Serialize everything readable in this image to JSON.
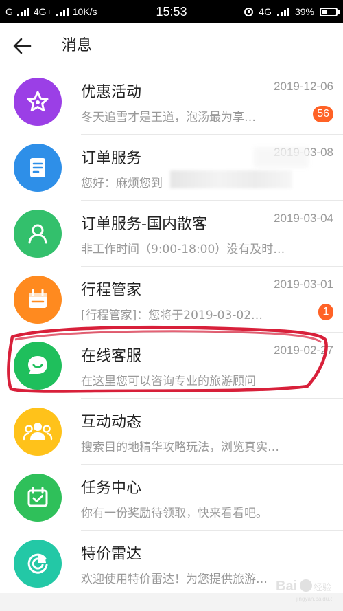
{
  "status_bar": {
    "network_left": "G",
    "network_second": "4G+",
    "speed": "10K/s",
    "time": "15:53",
    "network_right": "4G",
    "battery": "39%"
  },
  "header": {
    "title": "消息"
  },
  "messages": [
    {
      "name": "优惠活动",
      "date": "2019-12-06",
      "preview": "冬天追雪才是王道，泡汤最为享…",
      "badge": "56",
      "color": "#9b3fe6",
      "icon": "star-icon"
    },
    {
      "name": "订单服务",
      "date": "2019-03-08",
      "preview": "您好：麻烦您到",
      "badge": "",
      "color": "#2e8fe8",
      "icon": "document-icon"
    },
    {
      "name": "订单服务-国内散客",
      "date": "2019-03-04",
      "preview": "非工作时间（9:00-18:00）没有及时…",
      "badge": "",
      "color": "#33c06c",
      "icon": "person-icon"
    },
    {
      "name": "行程管家",
      "date": "2019-03-01",
      "preview": "[行程管家]：您将于2019-03-02…",
      "badge": "1",
      "color": "#ff8a1f",
      "icon": "calendar-icon"
    },
    {
      "name": "在线客服",
      "date": "2019-02-27",
      "preview": "在这里您可以咨询专业的旅游顾问",
      "badge": "",
      "color": "#1fbf5c",
      "icon": "chat-bubble-icon"
    },
    {
      "name": "互动动态",
      "date": "",
      "preview": "搜索目的地精华攻略玩法，浏览真实…",
      "badge": "",
      "color": "#ffc21a",
      "icon": "group-icon"
    },
    {
      "name": "任务中心",
      "date": "",
      "preview": "你有一份奖励待领取，快来看看吧。",
      "badge": "",
      "color": "#2fc05a",
      "icon": "task-check-icon"
    },
    {
      "name": "特价雷达",
      "date": "",
      "preview": "欢迎使用特价雷达！为您提供旅游…",
      "badge": "",
      "color": "#23c8a6",
      "icon": "radar-icon"
    }
  ],
  "watermark": "Baidu 经验"
}
